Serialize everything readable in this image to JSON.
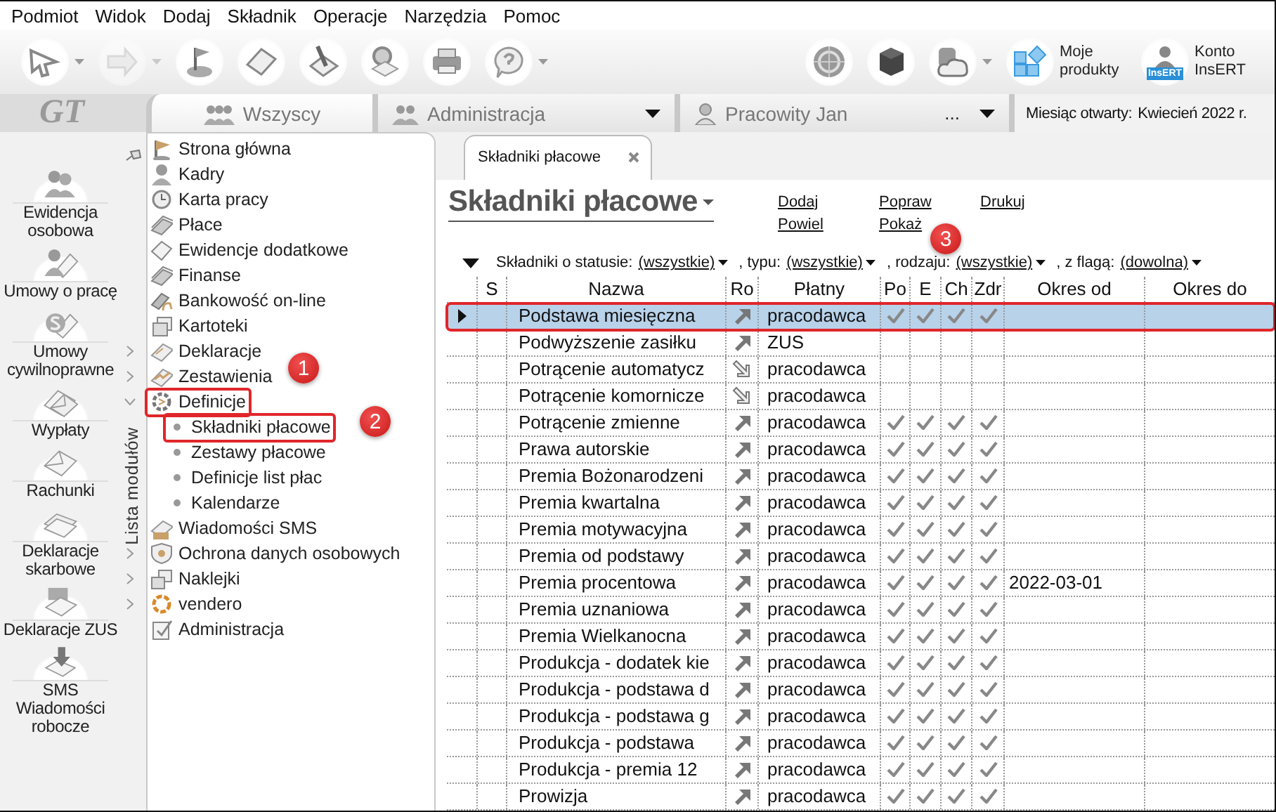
{
  "menu": [
    "Podmiot",
    "Widok",
    "Dodaj",
    "Składnik",
    "Operacje",
    "Narzędzia",
    "Pomoc"
  ],
  "toolbar": {
    "buttons": [
      {
        "dropdown": true,
        "disabled": false
      },
      {
        "dropdown": true,
        "disabled": true
      },
      {
        "dropdown": false,
        "disabled": false
      },
      {
        "dropdown": false,
        "disabled": false
      },
      {
        "dropdown": false,
        "disabled": false
      },
      {
        "dropdown": false,
        "disabled": false
      },
      {
        "dropdown": false,
        "disabled": false
      },
      {
        "dropdown": true,
        "disabled": false
      }
    ],
    "right_buttons": [
      {
        "dropdown": false
      },
      {
        "dropdown": false
      },
      {
        "dropdown": true
      }
    ],
    "products_button": {
      "label": "Moje produkty"
    },
    "account_button": {
      "label": "Konto InsERT",
      "icon_label": "InsERT"
    }
  },
  "logo": "GT",
  "tabs": [
    {
      "label": "Wszyscy",
      "selected": true,
      "dropdown": false
    },
    {
      "label": "Administracja",
      "selected": false,
      "dropdown": true
    },
    {
      "label": "Pracowity Jan",
      "selected": false,
      "dropdown": true,
      "more": "..."
    }
  ],
  "month": {
    "label": "Miesiąc otwarty:",
    "value": "Kwiecień 2022 r."
  },
  "sidebar": {
    "items": [
      "Ewidencja osobowa",
      "Umowy o pracę",
      "Umowy cywilnoprawne",
      "Wypłaty",
      "Rachunki",
      "Deklaracje skarbowe",
      "Deklaracje ZUS",
      "SMS Wiadomości robocze"
    ]
  },
  "module_list": {
    "title": "Lista modułów",
    "items": [
      {
        "label": "Strona główna"
      },
      {
        "label": "Kadry"
      },
      {
        "label": "Karta pracy"
      },
      {
        "label": "Płace"
      },
      {
        "label": "Ewidencje dodatkowe"
      },
      {
        "label": "Finanse"
      },
      {
        "label": "Bankowość on-line"
      },
      {
        "label": "Kartoteki"
      },
      {
        "label": "Deklaracje",
        "expanded": false
      },
      {
        "label": "Zestawienia",
        "expanded": false
      },
      {
        "label": "Definicje",
        "expanded": true,
        "annotated": true,
        "children": [
          {
            "label": "Składniki płacowe",
            "annotated": true
          },
          {
            "label": "Zestawy płacowe",
            "annotated": false
          },
          {
            "label": "Definicje list płac",
            "annotated": false
          },
          {
            "label": "Kalendarze",
            "annotated": false
          }
        ]
      },
      {
        "label": "Wiadomości SMS"
      },
      {
        "label": "Ochrona danych osobowych",
        "expanded": false
      },
      {
        "label": "Naklejki",
        "expanded": false
      },
      {
        "label": "vendero",
        "expanded": false
      },
      {
        "label": "Administracja"
      }
    ]
  },
  "document_tab": {
    "label": "Składniki płacowe"
  },
  "page": {
    "title": "Składniki płacowe",
    "actions": [
      "Dodaj",
      "Powiel",
      "Popraw",
      "Pokaż",
      "Drukuj"
    ]
  },
  "filters": [
    {
      "label": "Składniki o statusie:",
      "value": "(wszystkie)"
    },
    {
      "label": ", typu:",
      "value": "(wszystkie)"
    },
    {
      "label": ", rodzaju:",
      "value": "(wszystkie)"
    },
    {
      "label": ", z flagą:",
      "value": "(dowolna)"
    }
  ],
  "table": {
    "columns": [
      "S",
      "Nazwa",
      "Ro",
      "Płatny",
      "Po",
      "E",
      "Ch",
      "Zdr",
      "Okres od",
      "Okres do"
    ],
    "rows": [
      {
        "name": "Podstawa miesięczna",
        "kind": "up",
        "payer": "pracodawca",
        "checks": [
          true,
          true,
          true,
          true
        ],
        "selected": true,
        "annotated": true
      },
      {
        "name": "Podwyższenie zasiłku",
        "kind": "up",
        "payer": "ZUS",
        "checks": [
          false,
          false,
          false,
          false
        ],
        "selected": false,
        "annotated": false
      },
      {
        "name": "Potrącenie automatycz",
        "kind": "down",
        "payer": "pracodawca",
        "checks": [
          false,
          false,
          false,
          false
        ],
        "selected": false,
        "annotated": false
      },
      {
        "name": "Potrącenie komornicze",
        "kind": "down",
        "payer": "pracodawca",
        "checks": [
          false,
          false,
          false,
          false
        ],
        "selected": false,
        "annotated": false
      },
      {
        "name": "Potrącenie zmienne",
        "kind": "up",
        "payer": "pracodawca",
        "checks": [
          true,
          true,
          true,
          true
        ],
        "selected": false,
        "annotated": false
      },
      {
        "name": "Prawa autorskie",
        "kind": "up",
        "payer": "pracodawca",
        "checks": [
          true,
          true,
          true,
          true
        ],
        "selected": false,
        "annotated": false
      },
      {
        "name": "Premia Bożonarodzeni",
        "kind": "up",
        "payer": "pracodawca",
        "checks": [
          true,
          true,
          true,
          true
        ],
        "selected": false,
        "annotated": false
      },
      {
        "name": "Premia kwartalna",
        "kind": "up",
        "payer": "pracodawca",
        "checks": [
          true,
          true,
          true,
          true
        ],
        "selected": false,
        "annotated": false
      },
      {
        "name": "Premia motywacyjna",
        "kind": "up",
        "payer": "pracodawca",
        "checks": [
          true,
          true,
          true,
          true
        ],
        "selected": false,
        "annotated": false
      },
      {
        "name": "Premia od podstawy",
        "kind": "up",
        "payer": "pracodawca",
        "checks": [
          true,
          true,
          true,
          true
        ],
        "selected": false,
        "annotated": false
      },
      {
        "name": "Premia procentowa",
        "kind": "up",
        "payer": "pracodawca",
        "checks": [
          true,
          true,
          true,
          true
        ],
        "okres_od": "2022-03-01",
        "selected": false,
        "annotated": false
      },
      {
        "name": "Premia uznaniowa",
        "kind": "up",
        "payer": "pracodawca",
        "checks": [
          true,
          true,
          true,
          true
        ],
        "selected": false,
        "annotated": false
      },
      {
        "name": "Premia Wielkanocna",
        "kind": "up",
        "payer": "pracodawca",
        "checks": [
          true,
          true,
          true,
          true
        ],
        "selected": false,
        "annotated": false
      },
      {
        "name": "Produkcja - dodatek kie",
        "kind": "up",
        "payer": "pracodawca",
        "checks": [
          true,
          true,
          true,
          true
        ],
        "selected": false,
        "annotated": false
      },
      {
        "name": "Produkcja - podstawa d",
        "kind": "up",
        "payer": "pracodawca",
        "checks": [
          true,
          true,
          true,
          true
        ],
        "selected": false,
        "annotated": false
      },
      {
        "name": "Produkcja - podstawa g",
        "kind": "up",
        "payer": "pracodawca",
        "checks": [
          true,
          true,
          true,
          true
        ],
        "selected": false,
        "annotated": false
      },
      {
        "name": "Produkcja - podstawa",
        "kind": "up",
        "payer": "pracodawca",
        "checks": [
          true,
          true,
          true,
          true
        ],
        "selected": false,
        "annotated": false
      },
      {
        "name": "Produkcja - premia 12",
        "kind": "up",
        "payer": "pracodawca",
        "checks": [
          true,
          true,
          true,
          true
        ],
        "selected": false,
        "annotated": false
      },
      {
        "name": "Prowizja",
        "kind": "up",
        "payer": "pracodawca",
        "checks": [
          true,
          true,
          true,
          true
        ],
        "selected": false,
        "annotated": false
      }
    ]
  },
  "callouts": [
    {
      "number": "1"
    },
    {
      "number": "2"
    },
    {
      "number": "3"
    }
  ]
}
